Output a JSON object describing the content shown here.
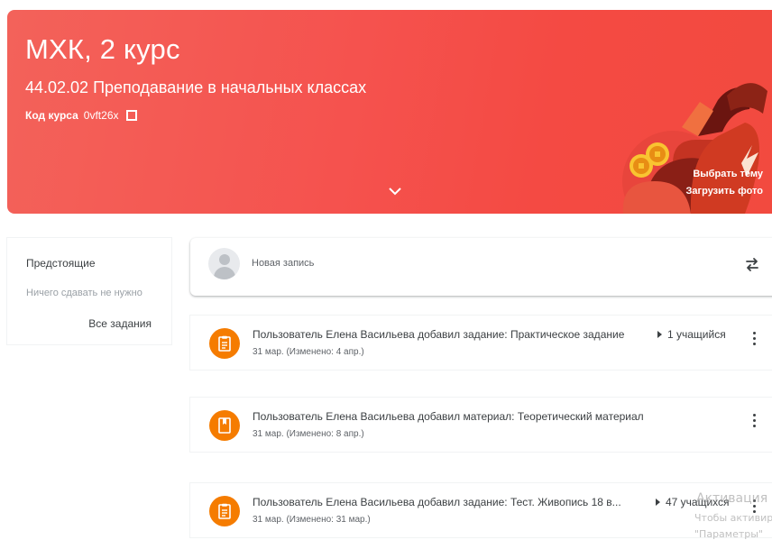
{
  "banner": {
    "title": "МХК, 2 курс",
    "subtitle": "44.02.02 Преподавание в начальных классах",
    "course_code_label": "Код курса",
    "course_code_value": "0vft26x",
    "select_theme": "Выбрать тему",
    "upload_photo": "Загрузить фото",
    "color": "#f4524d"
  },
  "upcoming": {
    "title": "Предстоящие",
    "empty_text": "Ничего сдавать не нужно",
    "all_tasks": "Все задания"
  },
  "newpost": {
    "label": "Новая запись"
  },
  "stream": [
    {
      "type": "assignment",
      "icon": "assignment-icon",
      "title": "Пользователь Елена Васильева добавил задание: Практическое задание",
      "date": "31 мар. (Изменено: 4 апр.)",
      "meta": "1 учащийся"
    },
    {
      "type": "material",
      "icon": "material-icon",
      "title": "Пользователь Елена Васильева добавил материал: Теоретический материал",
      "date": "31 мар. (Изменено: 8 апр.)",
      "meta": ""
    },
    {
      "type": "assignment",
      "icon": "assignment-icon",
      "title": "Пользователь Елена Васильева добавил задание: Тест. Живопись 18 в...",
      "date": "31 мар. (Изменено: 31 мар.)",
      "meta": "47 учащихся"
    }
  ],
  "watermark": {
    "line1": "Активация",
    "line2": "Чтобы активир",
    "line3": "\"Параметры\""
  },
  "colors": {
    "accent_orange": "#f57c00",
    "banner_red": "#f4524d"
  }
}
